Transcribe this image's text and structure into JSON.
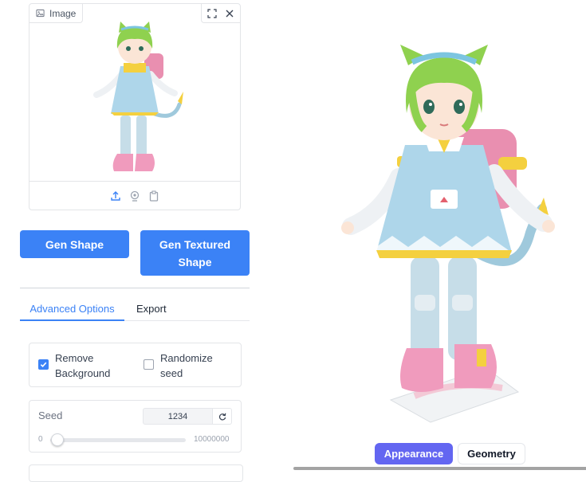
{
  "image_panel": {
    "label": "Image",
    "footer_icons": [
      "upload-icon",
      "webcam-icon",
      "clipboard-icon"
    ],
    "header_icons": [
      "fullscreen-icon",
      "close-icon"
    ]
  },
  "actions": {
    "gen_shape": "Gen Shape",
    "gen_textured": "Gen Textured Shape"
  },
  "tabs": [
    {
      "label": "Advanced Options",
      "active": true
    },
    {
      "label": "Export",
      "active": false
    }
  ],
  "options": {
    "remove_background": {
      "label": "Remove Background",
      "checked": true
    },
    "randomize_seed": {
      "label": "Randomize seed",
      "checked": false
    }
  },
  "seed": {
    "label": "Seed",
    "value": "1234",
    "min": "0",
    "max": "10000000",
    "slider_fraction": 0.000123
  },
  "viewer": {
    "modes": [
      "Appearance",
      "Geometry"
    ],
    "active_mode": "Appearance"
  },
  "colors": {
    "primary": "#3b82f6",
    "active_mode": "#6366f1"
  }
}
